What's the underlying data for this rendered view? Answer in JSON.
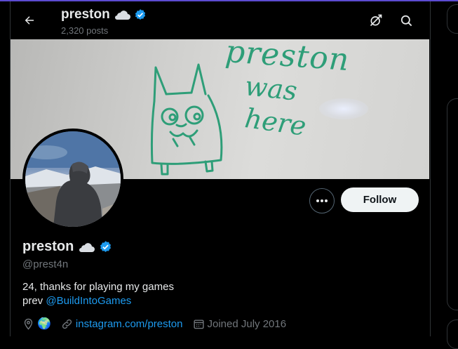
{
  "header": {
    "name": "preston",
    "name_emoji": "cloud",
    "verified": true,
    "posts": "2,320 posts"
  },
  "banner": {
    "handwriting": [
      "preston",
      "was",
      "here"
    ]
  },
  "profile": {
    "name": "preston",
    "handle": "@prest4n",
    "follow_label": "Follow",
    "bio_line1": "24, thanks for playing my games",
    "bio_prev": "prev",
    "bio_link": "@BuildIntoGames",
    "location_emoji": "🌍",
    "website": "instagram.com/preston",
    "joined": "Joined July 2016"
  },
  "colors": {
    "accent": "#1d9bf0",
    "background": "#000000",
    "marker": "#2e9e78"
  }
}
